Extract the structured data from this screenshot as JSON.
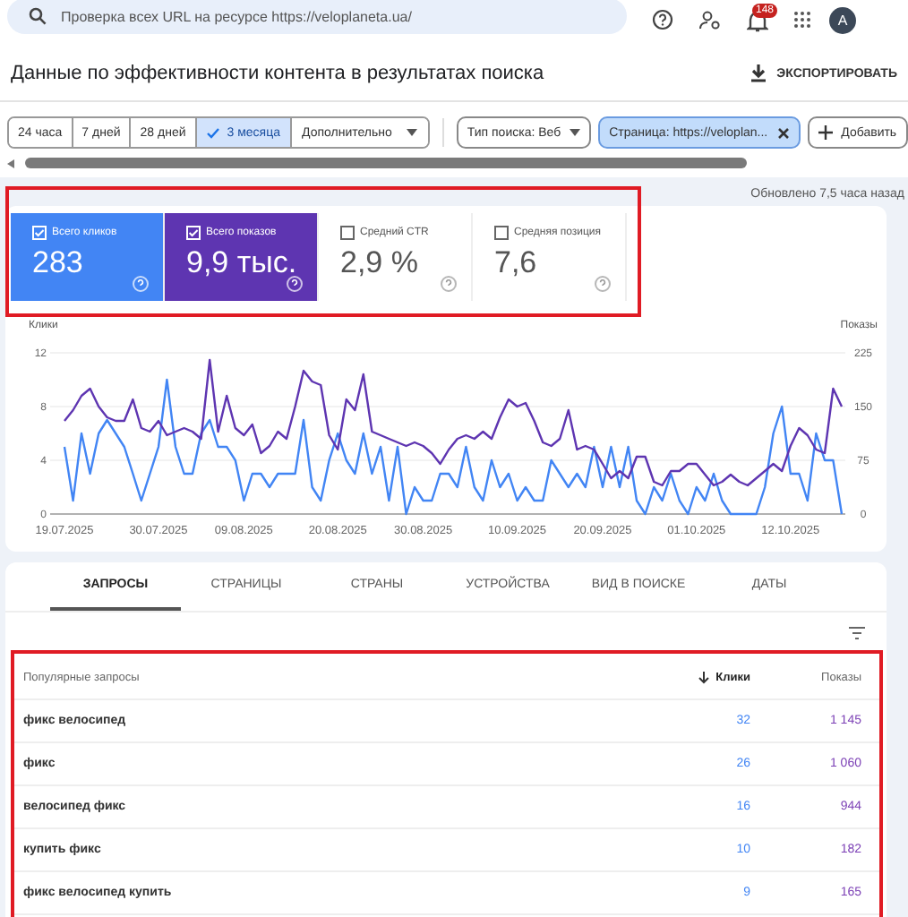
{
  "search": {
    "placeholder": "Проверка всех URL на ресурсе https://veloplaneta.ua/"
  },
  "notifications": {
    "badge": "148"
  },
  "avatar": {
    "letter": "A"
  },
  "title": "Данные по эффективности контента в результатах поиска",
  "export_button": "ЭКСПОРТИРОВАТЬ",
  "date_ranges": [
    {
      "label": "24 часа",
      "selected": false
    },
    {
      "label": "7 дней",
      "selected": false
    },
    {
      "label": "28 дней",
      "selected": false
    },
    {
      "label": "3 месяца",
      "selected": true
    },
    {
      "label": "Дополнительно",
      "selected": false
    }
  ],
  "filters": [
    {
      "kind": "dropdown",
      "label": "Тип поиска: Веб"
    },
    {
      "kind": "removable",
      "label": "Страница: https://veloplan..."
    },
    {
      "kind": "add",
      "label": "Добавить"
    }
  ],
  "updated": "Обновлено 7,5 часа назад",
  "metrics": [
    {
      "label": "Всего кликов",
      "value": "283",
      "checked": true,
      "color": "#4285f4"
    },
    {
      "label": "Всего показов",
      "value": "9,9 тыс.",
      "checked": true,
      "color": "#5e35b1"
    },
    {
      "label": "Средний CTR",
      "value": "2,9 %",
      "checked": false
    },
    {
      "label": "Средняя позиция",
      "value": "7,6",
      "checked": false
    }
  ],
  "clicks_chart": {
    "chart_data": {
      "type": "line",
      "ylabel": "Клики",
      "ylim": [
        0,
        12
      ],
      "yticks": [
        0,
        4,
        8,
        12
      ],
      "categories": [
        "19.07.2025",
        null,
        null,
        null,
        null,
        null,
        null,
        null,
        null,
        null,
        null,
        "30.07.2025",
        null,
        null,
        null,
        null,
        null,
        null,
        null,
        null,
        null,
        "09.08.2025",
        null,
        null,
        null,
        null,
        null,
        null,
        null,
        null,
        null,
        null,
        "20.08.2025",
        null,
        null,
        null,
        null,
        null,
        null,
        null,
        null,
        null,
        "30.08.2025",
        null,
        null,
        null,
        null,
        null,
        null,
        null,
        null,
        null,
        null,
        "10.09.2025",
        null,
        null,
        null,
        null,
        null,
        null,
        null,
        null,
        null,
        "20.09.2025",
        null,
        null,
        null,
        null,
        null,
        null,
        null,
        null,
        null,
        null,
        "01.10.2025",
        null,
        null,
        null,
        null,
        null,
        null,
        null,
        null,
        null,
        null,
        "12.10.2025",
        null,
        null,
        null,
        null,
        null,
        null
      ],
      "series": [
        {
          "color": "#4285f4",
          "values": [
            5,
            1,
            6,
            3,
            6,
            7,
            6,
            5,
            3,
            1,
            3,
            5,
            10,
            5,
            3,
            3,
            6,
            7,
            5,
            5,
            4,
            1,
            3,
            3,
            2,
            3,
            3,
            3,
            7,
            2,
            1,
            4,
            6,
            4,
            3,
            6,
            3,
            5,
            1,
            5,
            0,
            2,
            1,
            1,
            3,
            3,
            2,
            5,
            2,
            1,
            4,
            2,
            3,
            1,
            2,
            1,
            1,
            4,
            3,
            2,
            3,
            2,
            5,
            2,
            5,
            2,
            5,
            1,
            0,
            2,
            1,
            3,
            1,
            0,
            2,
            1,
            3,
            1,
            0,
            0,
            0,
            0,
            2,
            6,
            8,
            3,
            3,
            1,
            6,
            4,
            4,
            0
          ]
        }
      ]
    }
  },
  "impressions_chart": {
    "chart_data": {
      "type": "line",
      "ylabel": "Показы",
      "ylim": [
        0,
        225
      ],
      "yticks": [
        0,
        75,
        150,
        225
      ],
      "series": [
        {
          "color": "#5e35b1",
          "values": [
            130,
            145,
            165,
            175,
            150,
            135,
            130,
            130,
            160,
            120,
            115,
            130,
            110,
            115,
            120,
            115,
            105,
            215,
            115,
            165,
            120,
            110,
            125,
            85,
            95,
            115,
            105,
            150,
            200,
            185,
            180,
            110,
            90,
            160,
            145,
            195,
            115,
            110,
            105,
            100,
            95,
            100,
            95,
            85,
            70,
            90,
            105,
            110,
            105,
            115,
            105,
            135,
            160,
            150,
            155,
            130,
            100,
            95,
            105,
            145,
            90,
            95,
            90,
            70,
            50,
            60,
            50,
            80,
            80,
            45,
            40,
            60,
            60,
            70,
            70,
            55,
            40,
            45,
            55,
            45,
            40,
            50,
            60,
            70,
            60,
            95,
            120,
            110,
            90,
            85,
            175,
            150
          ]
        }
      ]
    }
  },
  "tabs": [
    {
      "label": "ЗАПРОСЫ",
      "selected": true
    },
    {
      "label": "СТРАНИЦЫ",
      "selected": false
    },
    {
      "label": "СТРАНЫ",
      "selected": false
    },
    {
      "label": "УСТРОЙСТВА",
      "selected": false
    },
    {
      "label": "ВИД В ПОИСКЕ",
      "selected": false
    },
    {
      "label": "ДАТЫ",
      "selected": false
    }
  ],
  "table": {
    "columns": [
      {
        "label": "Популярные запросы",
        "sorted": false
      },
      {
        "label": "Клики",
        "sorted": true
      },
      {
        "label": "Показы",
        "sorted": false
      }
    ],
    "rows": [
      [
        "фикс велосипед",
        "32",
        "1 145"
      ],
      [
        "фикс",
        "26",
        "1 060"
      ],
      [
        "велосипед фикс",
        "16",
        "944"
      ],
      [
        "купить фикс",
        "10",
        "182"
      ],
      [
        "фикс велосипед купить",
        "9",
        "165"
      ]
    ]
  }
}
